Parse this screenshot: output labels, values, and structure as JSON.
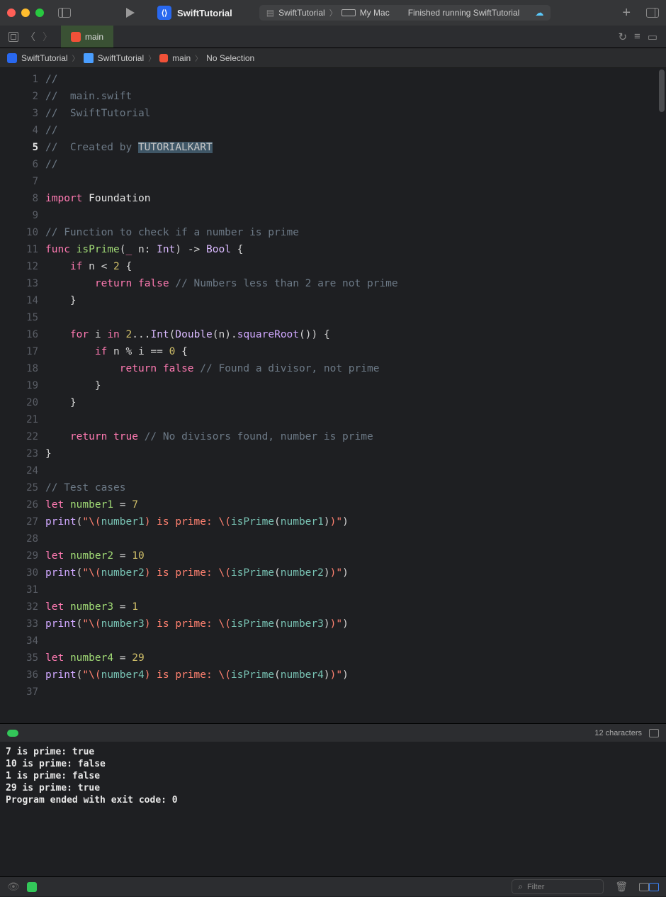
{
  "title": {
    "app": "SwiftTutorial",
    "scheme": "SwiftTutorial",
    "device": "My Mac",
    "status": "Finished running SwiftTutorial"
  },
  "tab": {
    "name": "main"
  },
  "path": {
    "p1": "SwiftTutorial",
    "p2": "SwiftTutorial",
    "p3": "main",
    "p4": "No Selection"
  },
  "highlighted_line": 5,
  "code": [
    {
      "n": 1,
      "t": [
        {
          "c": "cmt",
          "v": "//"
        }
      ]
    },
    {
      "n": 2,
      "t": [
        {
          "c": "cmt",
          "v": "//  main.swift"
        }
      ]
    },
    {
      "n": 3,
      "t": [
        {
          "c": "cmt",
          "v": "//  SwiftTutorial"
        }
      ]
    },
    {
      "n": 4,
      "t": [
        {
          "c": "cmt",
          "v": "//"
        }
      ]
    },
    {
      "n": 5,
      "t": [
        {
          "c": "cmt",
          "v": "//  Created by "
        },
        {
          "c": "sel",
          "v": "TUTORIALKART"
        }
      ]
    },
    {
      "n": 6,
      "t": [
        {
          "c": "cmt",
          "v": "//"
        }
      ]
    },
    {
      "n": 7,
      "t": []
    },
    {
      "n": 8,
      "t": [
        {
          "c": "kw",
          "v": "import"
        },
        {
          "c": "text",
          "v": " Foundation"
        }
      ]
    },
    {
      "n": 9,
      "t": []
    },
    {
      "n": 10,
      "t": [
        {
          "c": "cmt",
          "v": "// Function to check if a number is prime"
        }
      ]
    },
    {
      "n": 11,
      "t": [
        {
          "c": "kw",
          "v": "func"
        },
        {
          "c": "id",
          "v": " "
        },
        {
          "c": "func",
          "v": "isPrime"
        },
        {
          "c": "id",
          "v": "("
        },
        {
          "c": "kw",
          "v": "_"
        },
        {
          "c": "id",
          "v": " n: "
        },
        {
          "c": "type",
          "v": "Int"
        },
        {
          "c": "id",
          "v": ") -> "
        },
        {
          "c": "type",
          "v": "Bool"
        },
        {
          "c": "id",
          "v": " {"
        }
      ]
    },
    {
      "n": 12,
      "t": [
        {
          "c": "id",
          "v": "    "
        },
        {
          "c": "kw",
          "v": "if"
        },
        {
          "c": "id",
          "v": " n < "
        },
        {
          "c": "num",
          "v": "2"
        },
        {
          "c": "id",
          "v": " {"
        }
      ]
    },
    {
      "n": 13,
      "t": [
        {
          "c": "id",
          "v": "        "
        },
        {
          "c": "kw",
          "v": "return"
        },
        {
          "c": "id",
          "v": " "
        },
        {
          "c": "kw",
          "v": "false"
        },
        {
          "c": "id",
          "v": " "
        },
        {
          "c": "cmt",
          "v": "// Numbers less than 2 are not prime"
        }
      ]
    },
    {
      "n": 14,
      "t": [
        {
          "c": "id",
          "v": "    }"
        }
      ]
    },
    {
      "n": 15,
      "t": []
    },
    {
      "n": 16,
      "t": [
        {
          "c": "id",
          "v": "    "
        },
        {
          "c": "kw",
          "v": "for"
        },
        {
          "c": "id",
          "v": " i "
        },
        {
          "c": "kw",
          "v": "in"
        },
        {
          "c": "id",
          "v": " "
        },
        {
          "c": "num",
          "v": "2"
        },
        {
          "c": "id",
          "v": "..."
        },
        {
          "c": "type",
          "v": "Int"
        },
        {
          "c": "id",
          "v": "("
        },
        {
          "c": "type",
          "v": "Double"
        },
        {
          "c": "id",
          "v": "(n)."
        },
        {
          "c": "prop",
          "v": "squareRoot"
        },
        {
          "c": "id",
          "v": "()) {"
        }
      ]
    },
    {
      "n": 17,
      "t": [
        {
          "c": "id",
          "v": "        "
        },
        {
          "c": "kw",
          "v": "if"
        },
        {
          "c": "id",
          "v": " n % i == "
        },
        {
          "c": "num",
          "v": "0"
        },
        {
          "c": "id",
          "v": " {"
        }
      ]
    },
    {
      "n": 18,
      "t": [
        {
          "c": "id",
          "v": "            "
        },
        {
          "c": "kw",
          "v": "return"
        },
        {
          "c": "id",
          "v": " "
        },
        {
          "c": "kw",
          "v": "false"
        },
        {
          "c": "id",
          "v": " "
        },
        {
          "c": "cmt",
          "v": "// Found a divisor, not prime"
        }
      ]
    },
    {
      "n": 19,
      "t": [
        {
          "c": "id",
          "v": "        }"
        }
      ]
    },
    {
      "n": 20,
      "t": [
        {
          "c": "id",
          "v": "    }"
        }
      ]
    },
    {
      "n": 21,
      "t": []
    },
    {
      "n": 22,
      "t": [
        {
          "c": "id",
          "v": "    "
        },
        {
          "c": "kw",
          "v": "return"
        },
        {
          "c": "id",
          "v": " "
        },
        {
          "c": "kw",
          "v": "true"
        },
        {
          "c": "id",
          "v": " "
        },
        {
          "c": "cmt",
          "v": "// No divisors found, number is prime"
        }
      ]
    },
    {
      "n": 23,
      "t": [
        {
          "c": "id",
          "v": "}"
        }
      ]
    },
    {
      "n": 24,
      "t": []
    },
    {
      "n": 25,
      "t": [
        {
          "c": "cmt",
          "v": "// Test cases"
        }
      ]
    },
    {
      "n": 26,
      "t": [
        {
          "c": "kw",
          "v": "let"
        },
        {
          "c": "id",
          "v": " "
        },
        {
          "c": "func",
          "v": "number1"
        },
        {
          "c": "id",
          "v": " = "
        },
        {
          "c": "num",
          "v": "7"
        }
      ]
    },
    {
      "n": 27,
      "t": [
        {
          "c": "prop",
          "v": "print"
        },
        {
          "c": "id",
          "v": "("
        },
        {
          "c": "str",
          "v": "\"\\("
        },
        {
          "c": "var",
          "v": "number1"
        },
        {
          "c": "str",
          "v": ") is prime: \\("
        },
        {
          "c": "var",
          "v": "isPrime"
        },
        {
          "c": "id",
          "v": "("
        },
        {
          "c": "var",
          "v": "number1"
        },
        {
          "c": "id",
          "v": ")"
        },
        {
          "c": "str",
          "v": ")\""
        },
        {
          "c": "id",
          "v": ")"
        }
      ]
    },
    {
      "n": 28,
      "t": []
    },
    {
      "n": 29,
      "t": [
        {
          "c": "kw",
          "v": "let"
        },
        {
          "c": "id",
          "v": " "
        },
        {
          "c": "func",
          "v": "number2"
        },
        {
          "c": "id",
          "v": " = "
        },
        {
          "c": "num",
          "v": "10"
        }
      ]
    },
    {
      "n": 30,
      "t": [
        {
          "c": "prop",
          "v": "print"
        },
        {
          "c": "id",
          "v": "("
        },
        {
          "c": "str",
          "v": "\"\\("
        },
        {
          "c": "var",
          "v": "number2"
        },
        {
          "c": "str",
          "v": ") is prime: \\("
        },
        {
          "c": "var",
          "v": "isPrime"
        },
        {
          "c": "id",
          "v": "("
        },
        {
          "c": "var",
          "v": "number2"
        },
        {
          "c": "id",
          "v": ")"
        },
        {
          "c": "str",
          "v": ")\""
        },
        {
          "c": "id",
          "v": ")"
        }
      ]
    },
    {
      "n": 31,
      "t": []
    },
    {
      "n": 32,
      "t": [
        {
          "c": "kw",
          "v": "let"
        },
        {
          "c": "id",
          "v": " "
        },
        {
          "c": "func",
          "v": "number3"
        },
        {
          "c": "id",
          "v": " = "
        },
        {
          "c": "num",
          "v": "1"
        }
      ]
    },
    {
      "n": 33,
      "t": [
        {
          "c": "prop",
          "v": "print"
        },
        {
          "c": "id",
          "v": "("
        },
        {
          "c": "str",
          "v": "\"\\("
        },
        {
          "c": "var",
          "v": "number3"
        },
        {
          "c": "str",
          "v": ") is prime: \\("
        },
        {
          "c": "var",
          "v": "isPrime"
        },
        {
          "c": "id",
          "v": "("
        },
        {
          "c": "var",
          "v": "number3"
        },
        {
          "c": "id",
          "v": ")"
        },
        {
          "c": "str",
          "v": ")\""
        },
        {
          "c": "id",
          "v": ")"
        }
      ]
    },
    {
      "n": 34,
      "t": []
    },
    {
      "n": 35,
      "t": [
        {
          "c": "kw",
          "v": "let"
        },
        {
          "c": "id",
          "v": " "
        },
        {
          "c": "func",
          "v": "number4"
        },
        {
          "c": "id",
          "v": " = "
        },
        {
          "c": "num",
          "v": "29"
        }
      ]
    },
    {
      "n": 36,
      "t": [
        {
          "c": "prop",
          "v": "print"
        },
        {
          "c": "id",
          "v": "("
        },
        {
          "c": "str",
          "v": "\"\\("
        },
        {
          "c": "var",
          "v": "number4"
        },
        {
          "c": "str",
          "v": ") is prime: \\("
        },
        {
          "c": "var",
          "v": "isPrime"
        },
        {
          "c": "id",
          "v": "("
        },
        {
          "c": "var",
          "v": "number4"
        },
        {
          "c": "id",
          "v": ")"
        },
        {
          "c": "str",
          "v": ")\""
        },
        {
          "c": "id",
          "v": ")"
        }
      ]
    },
    {
      "n": 37,
      "t": []
    }
  ],
  "console_status": {
    "chars": "12 characters"
  },
  "console_output": "7 is prime: true\n10 is prime: false\n1 is prime: false\n29 is prime: true\nProgram ended with exit code: 0",
  "filter": {
    "placeholder": "Filter"
  }
}
